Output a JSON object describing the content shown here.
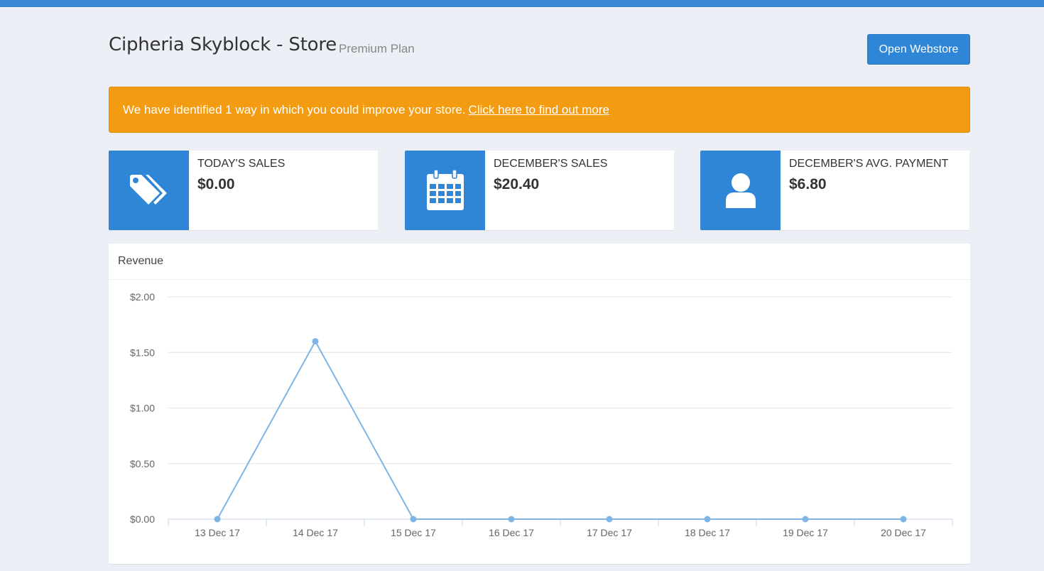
{
  "header": {
    "title": "Cipheria Skyblock - Store",
    "plan": "Premium Plan",
    "open_webstore": "Open Webstore"
  },
  "alert": {
    "text": "We have identified 1 way in which you could improve your store.",
    "link": "Click here to find out more"
  },
  "stats": [
    {
      "label": "TODAY'S SALES",
      "value": "$0.00",
      "icon": "tags-icon"
    },
    {
      "label": "DECEMBER'S SALES",
      "value": "$20.40",
      "icon": "calendar-icon"
    },
    {
      "label": "DECEMBER'S AVG. PAYMENT",
      "value": "$6.80",
      "icon": "user-icon"
    }
  ],
  "colors": {
    "accent": "#2f86d6",
    "alert": "#f39c12",
    "line": "#7fb5e6",
    "topbar": "#3a87d6"
  },
  "revenue_panel": {
    "title": "Revenue"
  },
  "chart_data": {
    "type": "line",
    "title": "Revenue",
    "x": [
      "13 Dec 17",
      "14 Dec 17",
      "15 Dec 17",
      "16 Dec 17",
      "17 Dec 17",
      "18 Dec 17",
      "19 Dec 17",
      "20 Dec 17"
    ],
    "series": [
      {
        "values": [
          0,
          1.6,
          0,
          0,
          0,
          0,
          0,
          0
        ]
      }
    ],
    "yticks": [
      "$0.00",
      "$0.50",
      "$1.00",
      "$1.50",
      "$2.00"
    ],
    "ylim": [
      0,
      2
    ],
    "grid": true,
    "legend": "none"
  }
}
